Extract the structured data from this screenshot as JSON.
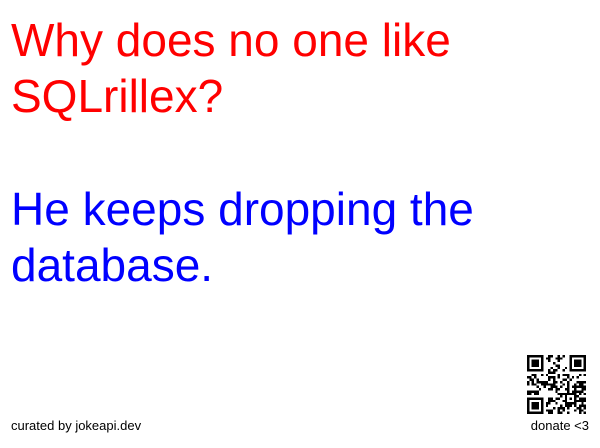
{
  "joke": {
    "setup": "Why does no one like SQLrillex?",
    "delivery": "He keeps dropping the database."
  },
  "footer": {
    "credit": "curated by jokeapi.dev",
    "donate": "donate <3"
  },
  "colors": {
    "setup": "#ff0000",
    "delivery": "#0000ff",
    "footer_text": "#000000",
    "background": "#ffffff"
  },
  "icons": {
    "qr": "qr-code-icon"
  }
}
